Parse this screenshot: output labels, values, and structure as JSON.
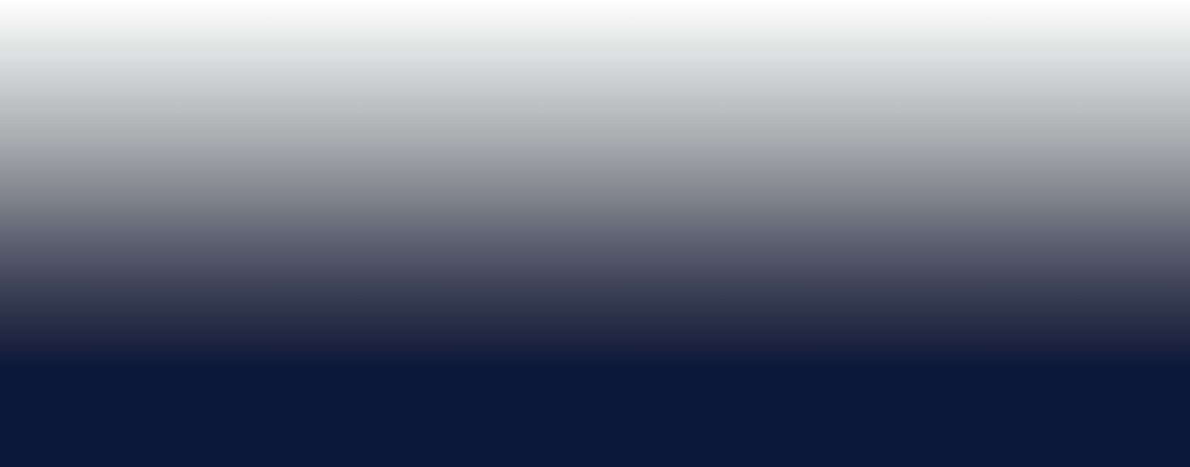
{
  "backdrop": {
    "colors": {
      "top": "#ffffff",
      "upper_mid": "#d4d5d6",
      "mid": "#80838c",
      "lower_mid": "#363c52",
      "bottom": "#0c1839"
    }
  }
}
